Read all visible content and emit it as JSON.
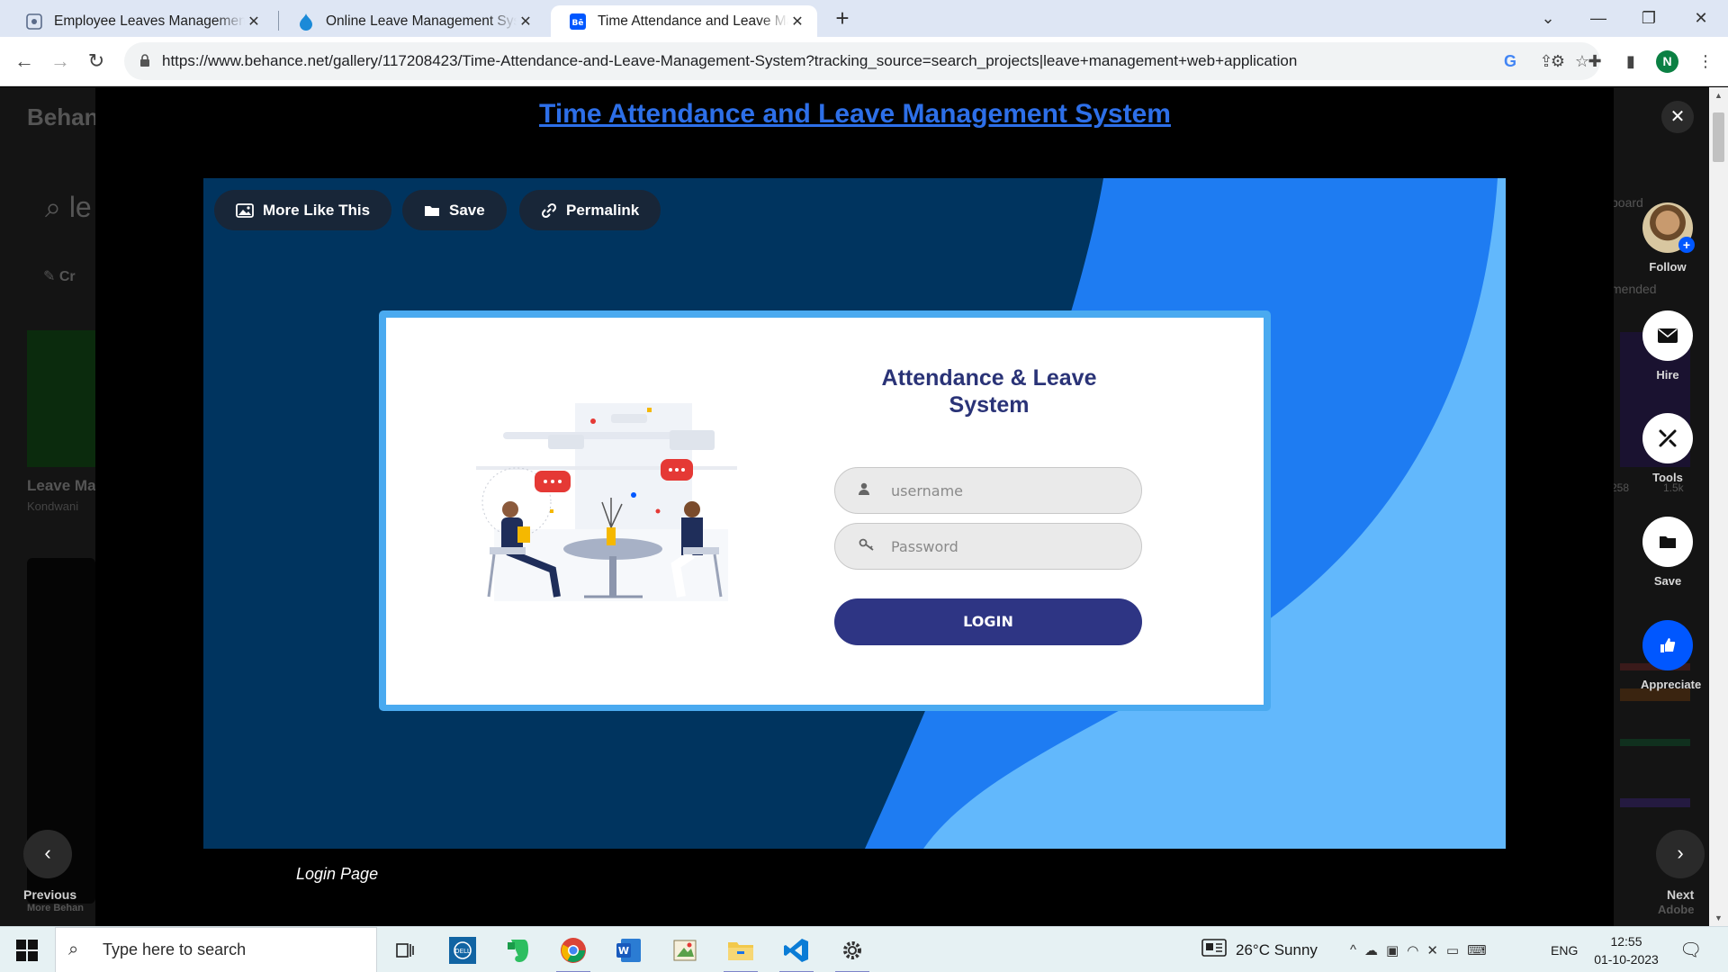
{
  "browser": {
    "tabs": [
      {
        "title": "Employee Leaves Management S",
        "favicon": "leaves-app-icon",
        "active": false
      },
      {
        "title": "Online Leave Management Syste",
        "favicon": "drupal-icon",
        "active": false
      },
      {
        "title": "Time Attendance and Leave Man",
        "favicon": "behance-icon",
        "active": true
      }
    ],
    "new_tab": "+",
    "url": "https://www.behance.net/gallery/117208423/Time-Attendance-and-Leave-Management-System?tracking_source=search_projects|leave+management+web+application",
    "profile_initial": "N"
  },
  "background_page": {
    "logo": "Behan",
    "search_fragment": "le",
    "create_label": "Cr",
    "card_title": "Leave Ma",
    "card_sub": "Kondwani",
    "right_text_1": "board",
    "right_text_2": "mended",
    "right_stats_1": "258",
    "right_stats_2": "1.5k",
    "bottom_left_1": "More Behan",
    "bottom_right_1": "Adobe"
  },
  "modal": {
    "project_title": "Time Attendance and Leave Management System",
    "pills": {
      "more_like_this": "More Like This",
      "save": "Save",
      "permalink": "Permalink"
    },
    "login_mock": {
      "app_title_line1": "Attendance & Leave",
      "app_title_line2": "System",
      "username_placeholder": "username",
      "password_placeholder": "Password",
      "login_button": "LOGIN"
    },
    "caption": "Login Page",
    "side": {
      "follow": "Follow",
      "hire": "Hire",
      "tools": "Tools",
      "save": "Save",
      "appreciate": "Appreciate"
    },
    "previous": "Previous",
    "next": "Next",
    "colors": {
      "stage_dark": "#00345f",
      "stage_mid": "#1e7cf2",
      "stage_light": "#62b8fc",
      "title_link": "#2d6fe8",
      "login_button": "#2e3584",
      "appreciate": "#0057ff"
    }
  },
  "taskbar": {
    "search_placeholder": "Type here to search",
    "weather": "26°C  Sunny",
    "language": "ENG",
    "time": "12:55",
    "date": "01-10-2023",
    "apps": [
      "task-view-icon",
      "dell-icon",
      "evernote-icon",
      "chrome-icon",
      "word-icon",
      "paint-icon",
      "file-explorer-icon",
      "vscode-icon",
      "settings-icon"
    ]
  }
}
